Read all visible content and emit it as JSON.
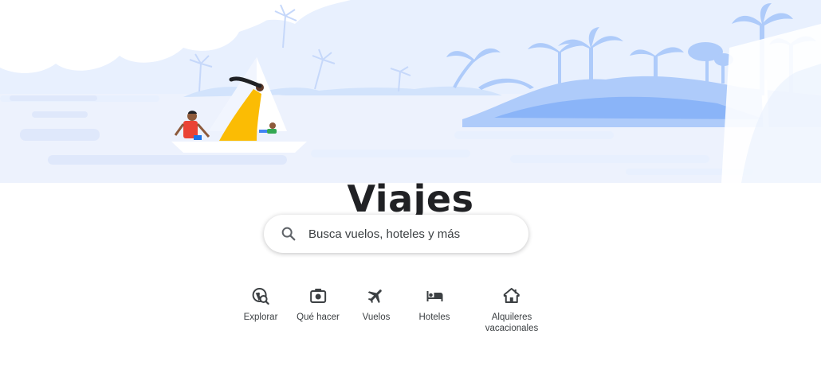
{
  "page": {
    "title": "Viajes"
  },
  "search": {
    "placeholder": "Busca vuelos, hoteles y más",
    "icon": "search-icon"
  },
  "nav": {
    "items": [
      {
        "label": "Explorar",
        "icon": "explore-icon"
      },
      {
        "label": "Qué hacer",
        "icon": "things-to-do-icon"
      },
      {
        "label": "Vuelos",
        "icon": "flight-icon"
      },
      {
        "label": "Hoteles",
        "icon": "hotel-bed-icon"
      },
      {
        "label": "Alquileres\nvacacionales",
        "icon": "vacation-rental-house-icon"
      }
    ]
  },
  "colors": {
    "sky_light": "#e8f0fe",
    "island": "#aecbfa",
    "island_dark": "#8ab4f8",
    "sail_yellow": "#fbbc04",
    "text": "#202124"
  }
}
